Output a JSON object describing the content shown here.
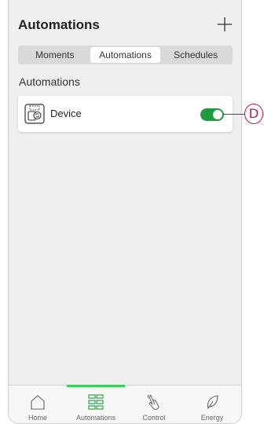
{
  "header": {
    "title": "Automations",
    "add_icon": "plus-icon"
  },
  "segments": [
    {
      "label": "Moments",
      "active": false
    },
    {
      "label": "Automations",
      "active": true
    },
    {
      "label": "Schedules",
      "active": false
    }
  ],
  "section": {
    "label": "Automations"
  },
  "automation": {
    "label": "Device",
    "icon": "device-automation-icon",
    "enabled": true
  },
  "callout": {
    "label": "D"
  },
  "tabs": [
    {
      "label": "Home",
      "icon": "home-icon"
    },
    {
      "label": "Automations",
      "icon": "grid-icon"
    },
    {
      "label": "Control",
      "icon": "hand-touch-icon"
    },
    {
      "label": "Energy",
      "icon": "leaf-icon"
    }
  ],
  "colors": {
    "accent": "#3dcd58",
    "toggle": "#1f9a3e",
    "callout": "#b5134f"
  }
}
